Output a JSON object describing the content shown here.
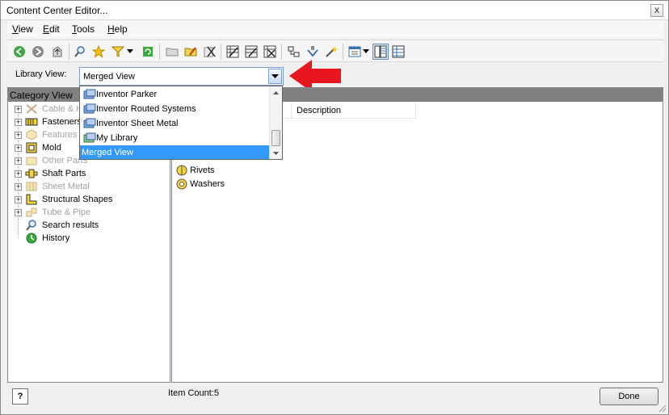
{
  "window": {
    "title": "Content Center Editor...",
    "close_glyph": "x"
  },
  "menu": [
    {
      "label_u": "V",
      "label_rest": "iew"
    },
    {
      "label_u": "E",
      "label_rest": "dit"
    },
    {
      "label_u": "T",
      "label_rest": "ools"
    },
    {
      "label_u": "H",
      "label_rest": "elp"
    }
  ],
  "toolbar": {
    "icons": [
      "back-icon",
      "forward-icon",
      "up-folder-icon",
      "find-icon",
      "favorites-star-icon",
      "filter-icon",
      "filter-dropdown-icon",
      "refresh-icon",
      "new-folder-icon",
      "edit-folder-icon",
      "delete-icon",
      "table-edit-icon",
      "family-properties-icon",
      "table-delete-icon",
      "category-icon",
      "publish-icon",
      "wizard-icon",
      "view-options-icon",
      "view-dropdown-icon",
      "tree-view-icon",
      "list-view-icon"
    ]
  },
  "library": {
    "label": "Library View:",
    "selected": "Merged View",
    "options": [
      {
        "label": "Inventor Parker"
      },
      {
        "label": "Inventor Routed Systems"
      },
      {
        "label": "Inventor Sheet Metal"
      },
      {
        "label": "My Library"
      },
      {
        "label": "Merged View"
      }
    ]
  },
  "category_panel": {
    "header": "Category View",
    "items": [
      {
        "label": "Cable & H",
        "icon": "cable-harness-icon",
        "dim": true,
        "expandable": true
      },
      {
        "label": "Fasteners",
        "icon": "fasteners-icon",
        "dim": false,
        "expandable": true
      },
      {
        "label": "Features",
        "icon": "features-icon",
        "dim": true,
        "expandable": true
      },
      {
        "label": "Mold",
        "icon": "mold-icon",
        "dim": false,
        "expandable": true
      },
      {
        "label": "Other Parts",
        "icon": "other-parts-icon",
        "dim": true,
        "expandable": true
      },
      {
        "label": "Shaft Parts",
        "icon": "shaft-parts-icon",
        "dim": false,
        "expandable": true
      },
      {
        "label": "Sheet Metal",
        "icon": "sheet-metal-icon",
        "dim": true,
        "expandable": true
      },
      {
        "label": "Structural Shapes",
        "icon": "structural-shapes-icon",
        "dim": false,
        "expandable": true
      },
      {
        "label": "Tube & Pipe",
        "icon": "tube-pipe-icon",
        "dim": true,
        "expandable": true
      },
      {
        "label": "Search results",
        "icon": "search-results-icon",
        "dim": false,
        "expandable": false
      },
      {
        "label": "History",
        "icon": "history-icon",
        "dim": false,
        "expandable": false
      }
    ]
  },
  "content_panel": {
    "columns": [
      "",
      "Description"
    ],
    "rows": [
      {
        "label": "Rivets",
        "icon": "rivets-icon"
      },
      {
        "label": "Washers",
        "icon": "washers-icon"
      }
    ]
  },
  "status": {
    "item_count": "Item Count:5"
  },
  "buttons": {
    "done": "Done",
    "help": "?"
  },
  "colors": {
    "accent": "#3399ff",
    "header_gray": "#808080",
    "arrow_red": "#e8161e"
  }
}
